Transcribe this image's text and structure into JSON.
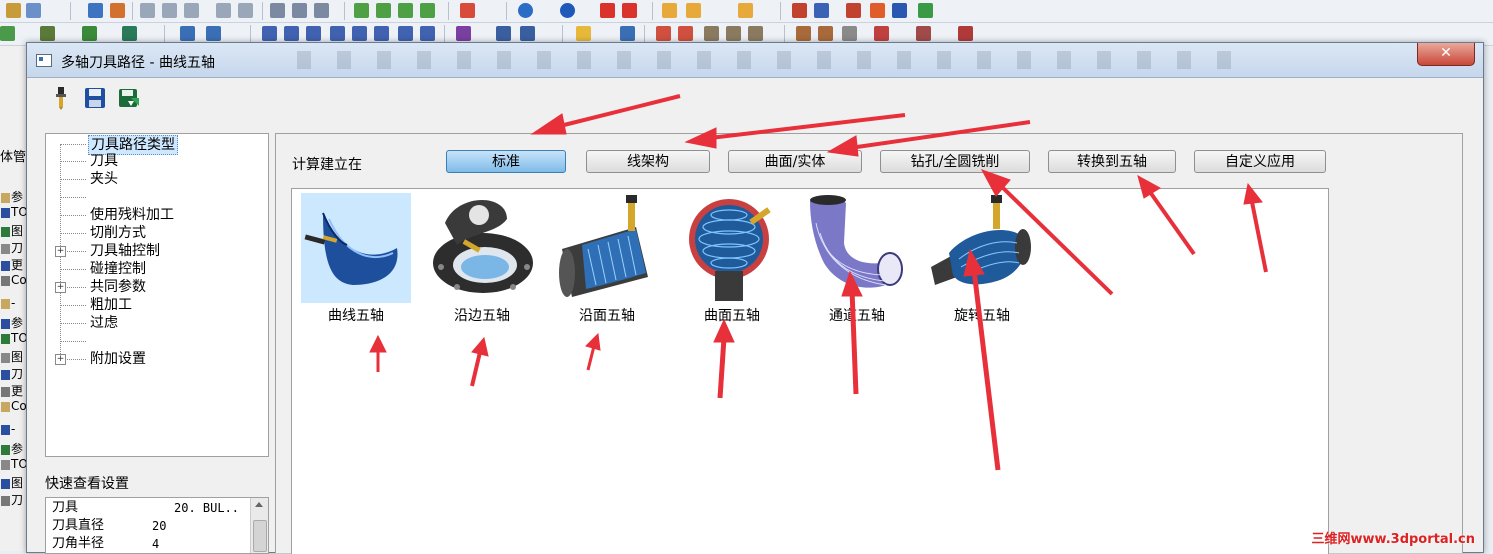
{
  "dialog": {
    "title": "多轴刀具路径 - 曲线五轴",
    "close_symbol": "✕"
  },
  "toolbar": {
    "tools": [
      {
        "icon": "tool-holder-icon"
      },
      {
        "icon": "save-icon"
      },
      {
        "icon": "save-as-icon"
      }
    ]
  },
  "tree": {
    "items": [
      {
        "label": "刀具路径类型",
        "selected": true
      },
      {
        "label": "刀具"
      },
      {
        "label": "夹头"
      },
      {
        "label": "使用残料加工"
      },
      {
        "label": "切削方式"
      },
      {
        "label": "刀具轴控制",
        "expandable": true
      },
      {
        "label": "碰撞控制"
      },
      {
        "label": "共同参数",
        "expandable": true
      },
      {
        "label": "粗加工"
      },
      {
        "label": "过虑"
      },
      {
        "label": "附加设置",
        "expandable": true
      }
    ]
  },
  "quick_view": {
    "title": "快速查看设置",
    "rows": [
      {
        "key": "刀具",
        "value": "20. BUL.."
      },
      {
        "key": "刀具直径",
        "value": "20"
      },
      {
        "key": "刀角半径",
        "value": "4"
      }
    ]
  },
  "main": {
    "calc_label": "计算建立在",
    "tabs": [
      {
        "label": "标准",
        "active": true
      },
      {
        "label": "线架构"
      },
      {
        "label": "曲面/实体"
      },
      {
        "label": "钻孔/全圆铣削"
      },
      {
        "label": "转换到五轴"
      },
      {
        "label": "自定义应用"
      }
    ],
    "methods": [
      {
        "label": "曲线五轴",
        "selected": true
      },
      {
        "label": "沿边五轴"
      },
      {
        "label": "沿面五轴"
      },
      {
        "label": "曲面五轴"
      },
      {
        "label": "通道五轴"
      },
      {
        "label": "旋转五轴"
      }
    ]
  },
  "app_left": {
    "header": "体管",
    "rows": [
      "参",
      "TO",
      "图",
      "刀",
      "更",
      "Co",
      "-",
      "参",
      "TO",
      "图",
      "刀",
      "更",
      "Co",
      "-",
      "参",
      "TO",
      "图",
      "刀"
    ]
  },
  "watermark": "三维网www.3dportal.cn",
  "colors": {
    "accent": "#7fbbe9",
    "annotation": "#e8303a",
    "selection": "#cce8ff"
  }
}
